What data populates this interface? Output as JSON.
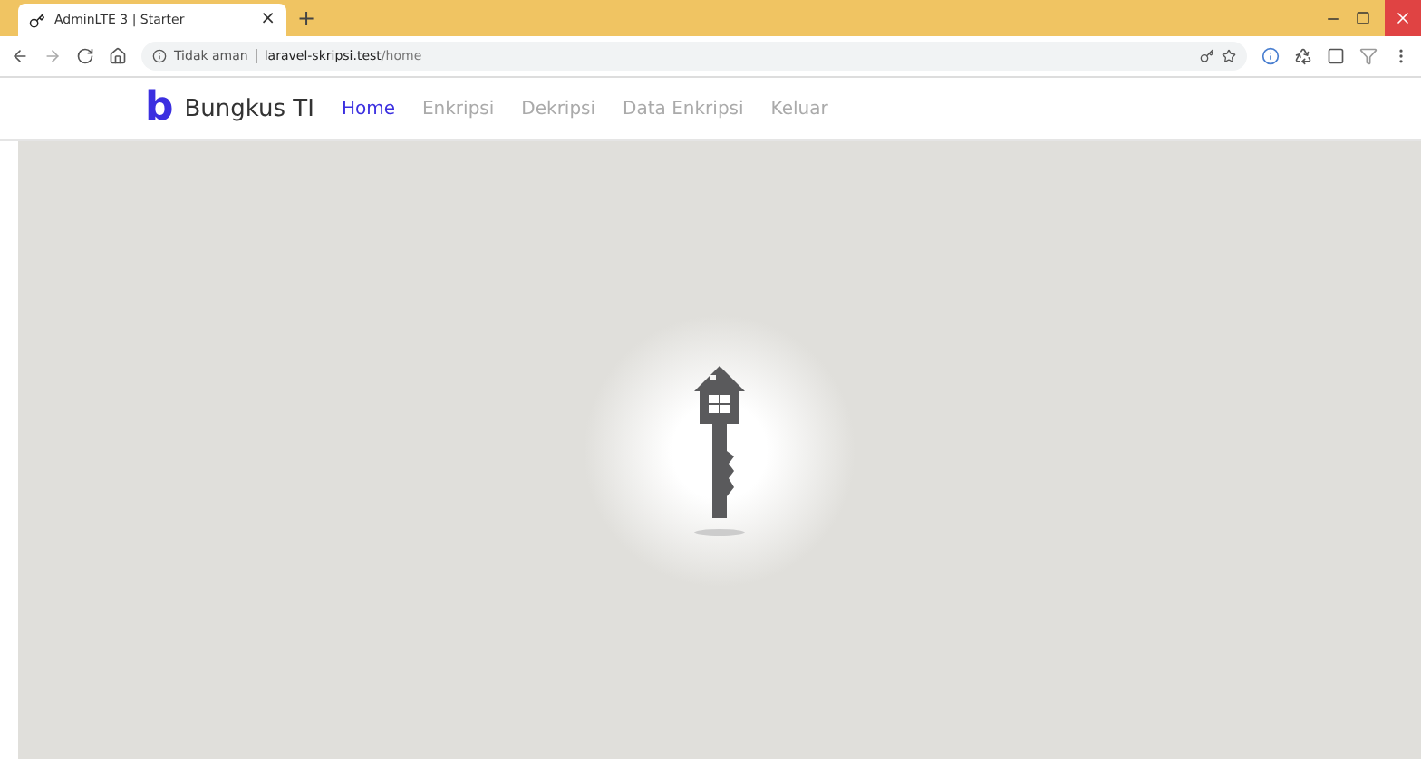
{
  "browser": {
    "tab_title": "AdminLTE 3 | Starter",
    "tab_close": "×",
    "new_tab": "+",
    "security": "Tidak aman",
    "url_host": "laravel-skripsi.test",
    "url_path": "/home"
  },
  "navbar": {
    "brand": "Bungkus TI",
    "brand_letter": "b",
    "items": [
      {
        "label": "Home",
        "selected": true
      },
      {
        "label": "Enkripsi",
        "selected": false
      },
      {
        "label": "Dekripsi",
        "selected": false
      },
      {
        "label": "Data Enkripsi",
        "selected": false
      },
      {
        "label": "Keluar",
        "selected": false
      }
    ]
  }
}
